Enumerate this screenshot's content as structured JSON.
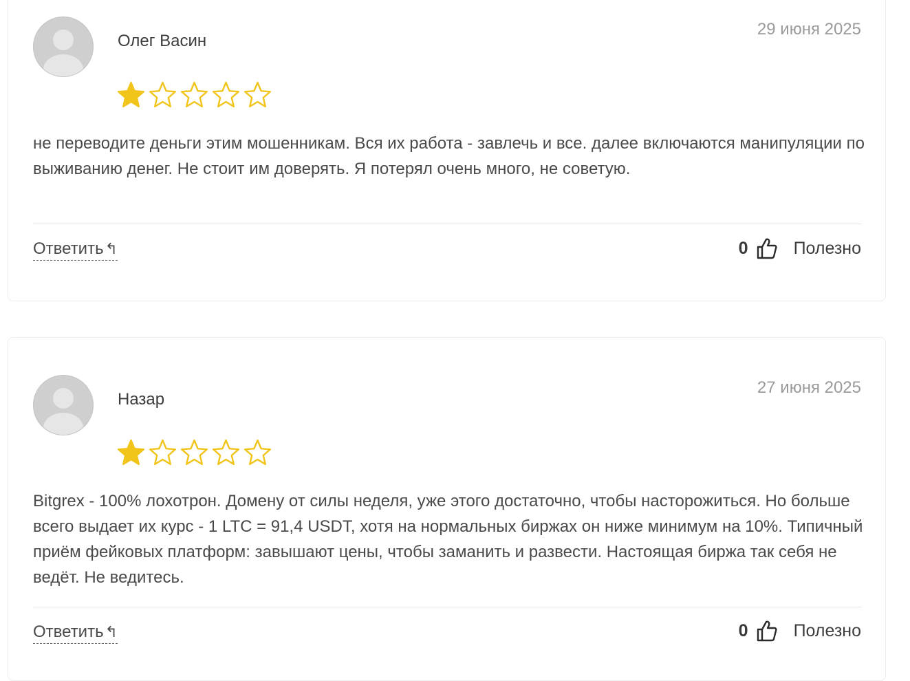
{
  "reviews": [
    {
      "author": "Олег Васин",
      "date": "29 июня 2025",
      "rating": 1,
      "rating_max": 5,
      "text": "не переводите деньги этим мошенникам. Вся их работа - завлечь и все. далее включаются манипуляции по выживанию денег. Не стоит им доверять. Я потерял очень много, не советую.",
      "reply_label": "Ответить",
      "reply_arrow": "↰",
      "likes": "0",
      "useful_label": "Полезно"
    },
    {
      "author": "Назар",
      "date": "27 июня 2025",
      "rating": 1,
      "rating_max": 5,
      "text": "Bitgrex - 100% лохотрон. Домену от силы неделя, уже этого достаточно, чтобы насторожиться. Но больше всего выдает их курс - 1 LTC = 91,4 USDT, хотя на нормальных биржах он ниже минимум на 10%. Типичный приём фейковых платформ: завышают цены, чтобы заманить и развести. Настоящая биржа так себя не ведёт. Не ведитесь.",
      "reply_label": "Ответить",
      "reply_arrow": "↰",
      "likes": "0",
      "useful_label": "Полезно"
    }
  ],
  "colors": {
    "star": "#f0c419",
    "muted": "#9a9a9a",
    "text": "#4a4a4a"
  },
  "icons": {
    "avatar": "user-avatar-icon",
    "star": "star-icon",
    "like": "thumbs-up-icon",
    "reply": "reply-arrow-icon"
  }
}
